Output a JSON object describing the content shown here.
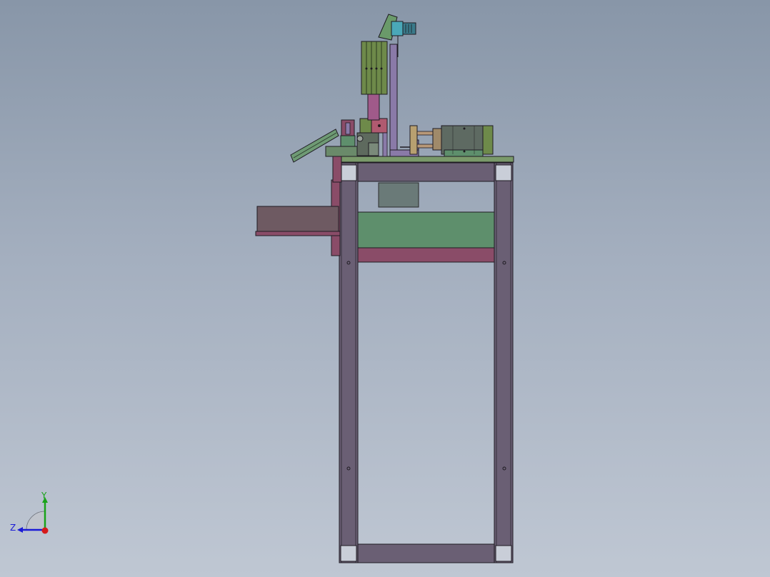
{
  "viewport": {
    "background_top": "#8896a8",
    "background_bottom": "#bfc7d3"
  },
  "triad": {
    "y_label": "Y",
    "z_label": "Z",
    "y_color": "#19a319",
    "z_color": "#1a1ad6",
    "x_color": "#d61a1a"
  },
  "colors": {
    "frame": "#6a5f74",
    "frame_edge": "#1e1b22",
    "plate_green": "#5e8f6c",
    "rail_maroon": "#8a4c68",
    "olive": "#6e8a4a",
    "lavender": "#8a7aa8",
    "motor_gray": "#5e6a62",
    "cyan": "#4aa8b8"
  }
}
